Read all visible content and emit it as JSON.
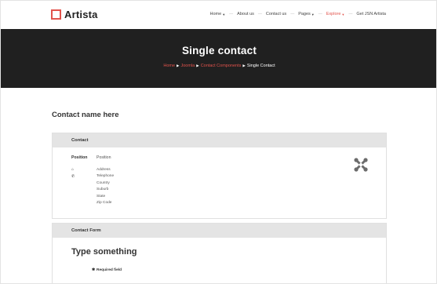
{
  "brand": {
    "name": "Artista",
    "accent": "#e2534c"
  },
  "nav": {
    "items": [
      {
        "label": "Home",
        "caret": true,
        "active": false
      },
      {
        "label": "About us",
        "caret": false,
        "active": false
      },
      {
        "label": "Contact us",
        "caret": false,
        "active": false
      },
      {
        "label": "Pages",
        "caret": true,
        "active": false
      },
      {
        "label": "Explore",
        "caret": true,
        "active": true
      },
      {
        "label": "Get JSN Artista",
        "caret": false,
        "active": false
      }
    ]
  },
  "hero": {
    "title": "Single contact",
    "breadcrumbs": [
      "Home",
      "Joomla",
      "Contact Components",
      "Single Contact"
    ]
  },
  "contact": {
    "name": "Contact name here",
    "panel_title": "Contact",
    "position_label": "Position",
    "position_value": "Position",
    "address_lines": [
      "Address",
      "Telephone",
      "Country",
      "Suburb",
      "State",
      "Zip Code"
    ],
    "address_icons": [
      "home-icon",
      "phone-icon"
    ],
    "image_icon": "joomla-logo-icon"
  },
  "form": {
    "panel_title": "Contact Form",
    "heading": "Type something",
    "required_note": "Required field"
  }
}
